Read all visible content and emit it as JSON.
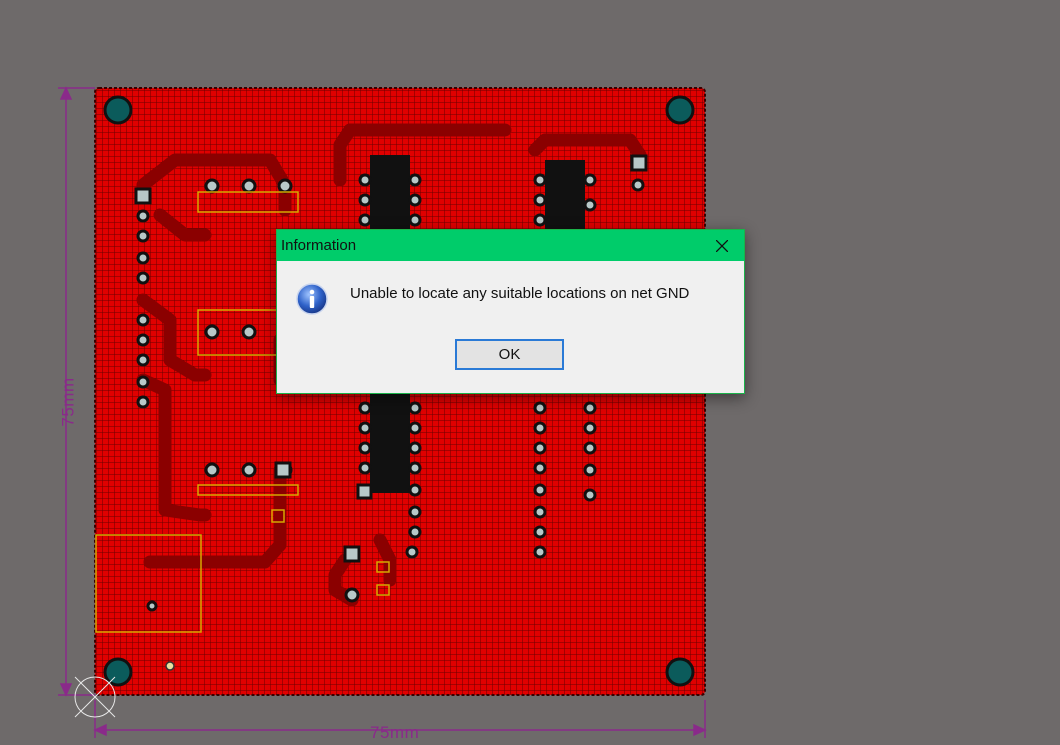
{
  "board": {
    "width_label": "75mm",
    "height_label": "75mm",
    "layer_color": "#e00000",
    "background_color": "#6e6a6a",
    "dimension_color": "#8a2a8a"
  },
  "dialog": {
    "title": "Information",
    "message": "Unable to locate any suitable locations on net GND",
    "ok_label": "OK",
    "icon": "info-icon",
    "close_icon": "close-icon",
    "titlebar_color": "#00cc6a"
  }
}
